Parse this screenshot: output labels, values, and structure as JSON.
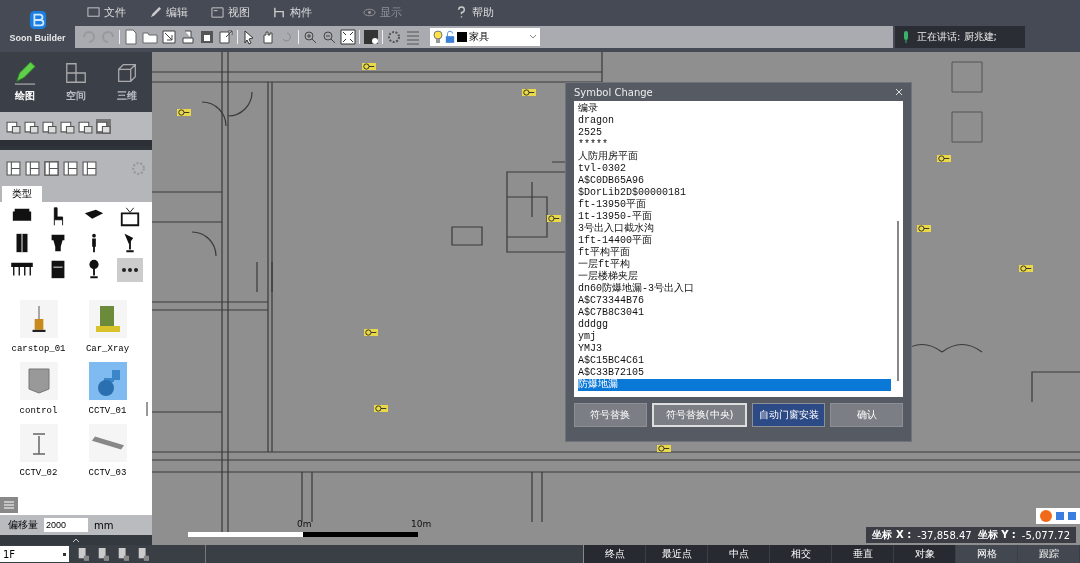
{
  "app": {
    "logo": "Soon Builder"
  },
  "menu": [
    {
      "label": "文件"
    },
    {
      "label": "编辑"
    },
    {
      "label": "视图"
    },
    {
      "label": "构件"
    },
    {
      "label": "显示",
      "disabled": true
    },
    {
      "label": "帮助"
    }
  ],
  "toolbar": {
    "layer": "家具"
  },
  "notification": {
    "text": "正在讲话: 厨兆建;"
  },
  "left_panel": {
    "modes": [
      {
        "label": "绘图",
        "selected": true
      },
      {
        "label": "空间",
        "selected": false
      },
      {
        "label": "三维",
        "selected": false
      }
    ],
    "type_tab": "类型",
    "library": [
      {
        "label": "carstop_01",
        "selected": false
      },
      {
        "label": "Car_Xray",
        "selected": false
      },
      {
        "label": "control",
        "selected": false
      },
      {
        "label": "CCTV_01",
        "selected": true
      },
      {
        "label": "CCTV_02",
        "selected": false
      },
      {
        "label": "CCTV_03",
        "selected": false
      }
    ],
    "offset": {
      "label": "偏移量",
      "value": "2000",
      "unit": "mm"
    },
    "floor": "1F"
  },
  "dialog": {
    "title": "Symbol Change",
    "items": [
      {
        "text": "编录",
        "selected": false
      },
      {
        "text": "dragon",
        "selected": false
      },
      {
        "text": "2525",
        "selected": false
      },
      {
        "text": "*****",
        "selected": false
      },
      {
        "text": "人防用房平面",
        "selected": false
      },
      {
        "text": "tvl-0302",
        "selected": false
      },
      {
        "text": "A$C0DB65A96",
        "selected": false
      },
      {
        "text": "$DorLib2D$00000181",
        "selected": false
      },
      {
        "text": "ft-13950平面",
        "selected": false
      },
      {
        "text": "1t-13950-平面",
        "selected": false
      },
      {
        "text": "3号出入口截水沟",
        "selected": false
      },
      {
        "text": "1ft-14400平面",
        "selected": false
      },
      {
        "text": "ft平构平面",
        "selected": false
      },
      {
        "text": "一层ft平构",
        "selected": false
      },
      {
        "text": "一层楼梯夹层",
        "selected": false
      },
      {
        "text": "dn60防爆地漏-3号出入口",
        "selected": false
      },
      {
        "text": "A$C73344B76",
        "selected": false
      },
      {
        "text": "A$C7B8C3041",
        "selected": false
      },
      {
        "text": "dddgg",
        "selected": false
      },
      {
        "text": "ymj",
        "selected": false
      },
      {
        "text": "YMJ3",
        "selected": false
      },
      {
        "text": "A$C15BC4C61",
        "selected": false
      },
      {
        "text": "A$C33B72105",
        "selected": false
      },
      {
        "text": "防爆地漏",
        "selected": true
      }
    ],
    "buttons": [
      {
        "label": "符号替换",
        "kind": "normal"
      },
      {
        "label": "符号替换(中央)",
        "kind": "outlined"
      },
      {
        "label": "自动门窗安装",
        "kind": "primary"
      },
      {
        "label": "确认",
        "kind": "normal"
      }
    ]
  },
  "scale_bar": {
    "labels": [
      "0m",
      "10m"
    ]
  },
  "coordinates": [
    {
      "label": "坐标 X :",
      "value": "-37,858.47"
    },
    {
      "label": "坐标 Y :",
      "value": "-5,077.72"
    }
  ],
  "snap_buttons": [
    {
      "label": "终点",
      "on": false
    },
    {
      "label": "最近点",
      "on": false
    },
    {
      "label": "中点",
      "on": false
    },
    {
      "label": "相交",
      "on": false
    },
    {
      "label": "垂直",
      "on": false
    },
    {
      "label": "对象",
      "on": false
    },
    {
      "label": "网格",
      "on": true
    },
    {
      "label": "跟踪",
      "on": true
    }
  ]
}
